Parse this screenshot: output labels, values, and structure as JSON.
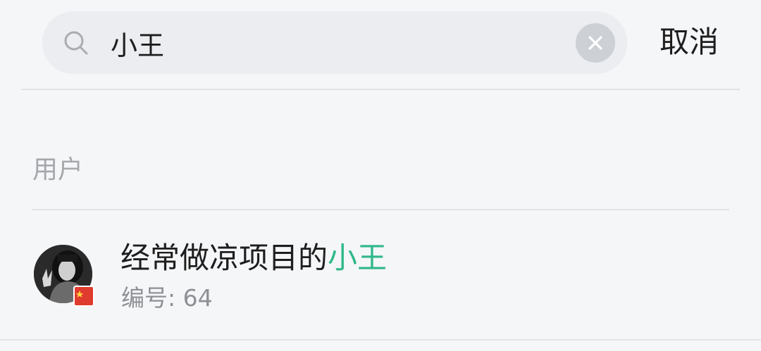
{
  "search": {
    "value": "小王",
    "icon": "search-icon",
    "clear_icon": "clear-icon"
  },
  "cancel_label": "取消",
  "section": {
    "label": "用户"
  },
  "results": [
    {
      "name_prefix": "经常做凉项目的",
      "name_highlight": "小王",
      "id_text": "编号: 64",
      "avatar_icon": "avatar",
      "badge_icon": "flag-badge-icon"
    }
  ],
  "colors": {
    "background": "#f5f6f8",
    "search_bg": "#ebedf0",
    "highlight": "#2fb888",
    "muted_text": "#a4a7ab"
  }
}
